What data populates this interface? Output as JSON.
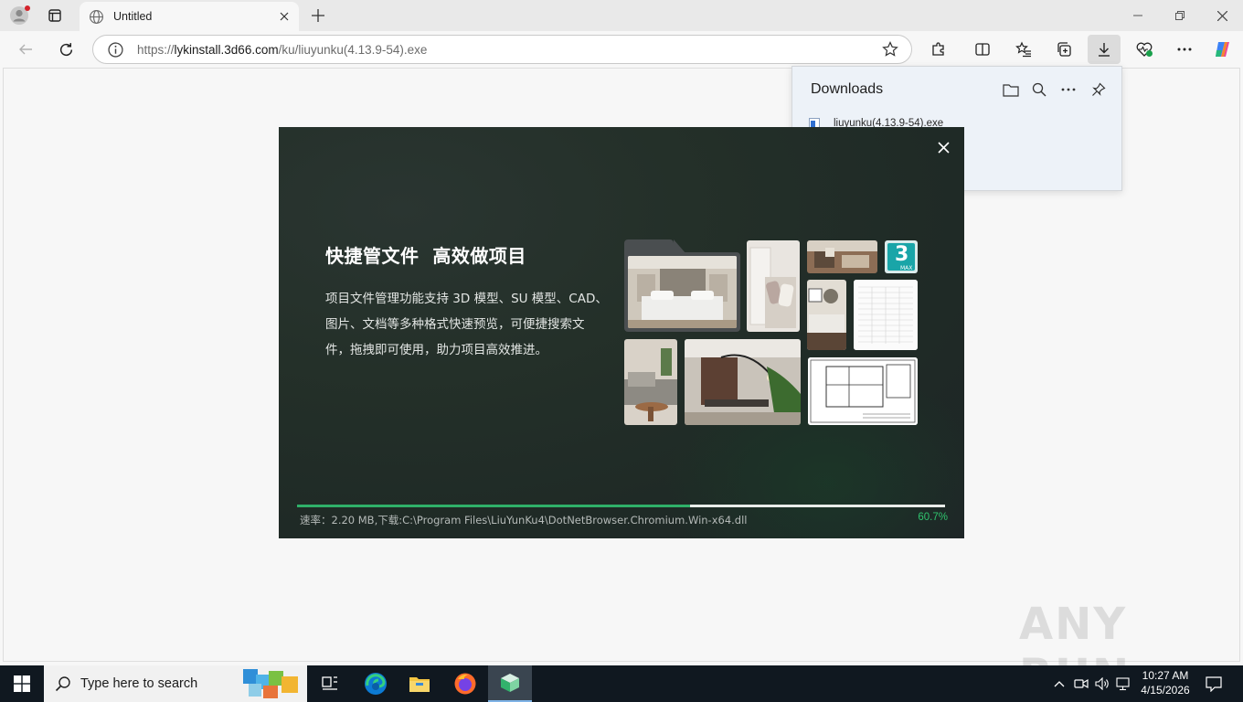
{
  "browser": {
    "tab_title": "Untitled",
    "url_prefix": "https://",
    "url_domain": "lykinstall.3d66.com",
    "url_path": "/ku/liuyunku(4.13.9-54).exe"
  },
  "downloads": {
    "title": "Downloads",
    "items": [
      {
        "filename": "liuyunku(4.13.9-54).exe"
      }
    ]
  },
  "installer": {
    "headline": "快捷管文件  高效做项目",
    "description": "项目文件管理功能支持 3D 模型、SU 模型、CAD、图片、文档等多种格式快速预览，可便捷搜索文件，拖拽即可使用，助力项目高效推进。",
    "status_text": "速率：2.20 MB,下载:C:\\Program Files\\LiuYunKu4\\DotNetBrowser.Chromium.Win-x64.dll",
    "progress_percent_label": "60.7%",
    "progress_fraction": 0.607,
    "max_badge_number": "3",
    "max_badge_text": "MAX",
    "accent_color": "#2fb069"
  },
  "watermark": {
    "text": "ANY RUN"
  },
  "taskbar": {
    "search_placeholder": "Type here to search",
    "time": "10:27 AM",
    "date": "4/15/2026"
  }
}
